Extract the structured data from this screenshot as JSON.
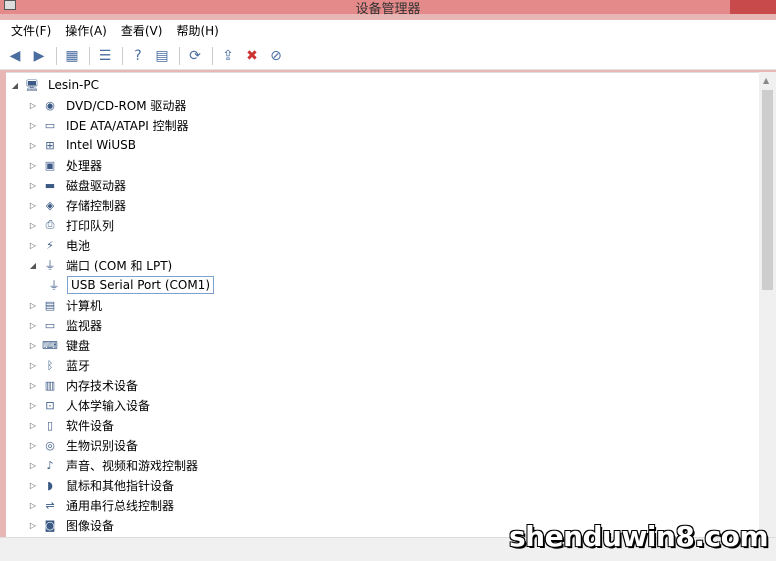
{
  "window": {
    "title": "设备管理器"
  },
  "menu": [
    {
      "label": "文件(F)"
    },
    {
      "label": "操作(A)"
    },
    {
      "label": "查看(V)"
    },
    {
      "label": "帮助(H)"
    }
  ],
  "toolbar": {
    "icons": [
      "back-icon",
      "forward-icon",
      "properties-icon",
      "list-icon",
      "help-icon",
      "view-icon",
      "scan-icon",
      "update-driver-icon",
      "uninstall-icon",
      "disable-icon"
    ]
  },
  "tree": {
    "root": {
      "label": "Lesin-PC",
      "icon": "computer-icon"
    },
    "items": [
      {
        "label": "DVD/CD-ROM 驱动器",
        "icon": "dvd-icon",
        "expanded": false
      },
      {
        "label": "IDE ATA/ATAPI 控制器",
        "icon": "ide-icon",
        "expanded": false
      },
      {
        "label": "Intel WiUSB",
        "icon": "network-icon",
        "expanded": false
      },
      {
        "label": "处理器",
        "icon": "cpu-icon",
        "expanded": false
      },
      {
        "label": "磁盘驱动器",
        "icon": "disk-icon",
        "expanded": false
      },
      {
        "label": "存储控制器",
        "icon": "storage-icon",
        "expanded": false
      },
      {
        "label": "打印队列",
        "icon": "printer-icon",
        "expanded": false
      },
      {
        "label": "电池",
        "icon": "battery-icon",
        "expanded": false
      },
      {
        "label": "端口 (COM 和 LPT)",
        "icon": "port-icon",
        "expanded": true,
        "children": [
          {
            "label": "USB Serial Port (COM1)",
            "icon": "port-icon",
            "selected": true
          }
        ]
      },
      {
        "label": "计算机",
        "icon": "computer-icon",
        "expanded": false
      },
      {
        "label": "监视器",
        "icon": "monitor-icon",
        "expanded": false
      },
      {
        "label": "键盘",
        "icon": "keyboard-icon",
        "expanded": false
      },
      {
        "label": "蓝牙",
        "icon": "bluetooth-icon",
        "expanded": false
      },
      {
        "label": "内存技术设备",
        "icon": "memory-icon",
        "expanded": false
      },
      {
        "label": "人体学输入设备",
        "icon": "hid-icon",
        "expanded": false
      },
      {
        "label": "软件设备",
        "icon": "software-device-icon",
        "expanded": false
      },
      {
        "label": "生物识别设备",
        "icon": "biometric-icon",
        "expanded": false
      },
      {
        "label": "声音、视频和游戏控制器",
        "icon": "sound-icon",
        "expanded": false
      },
      {
        "label": "鼠标和其他指针设备",
        "icon": "mouse-icon",
        "expanded": false
      },
      {
        "label": "通用串行总线控制器",
        "icon": "usb-icon",
        "expanded": false
      },
      {
        "label": "图像设备",
        "icon": "camera-icon",
        "expanded": false
      }
    ]
  },
  "watermark": "shenduwin8.com"
}
